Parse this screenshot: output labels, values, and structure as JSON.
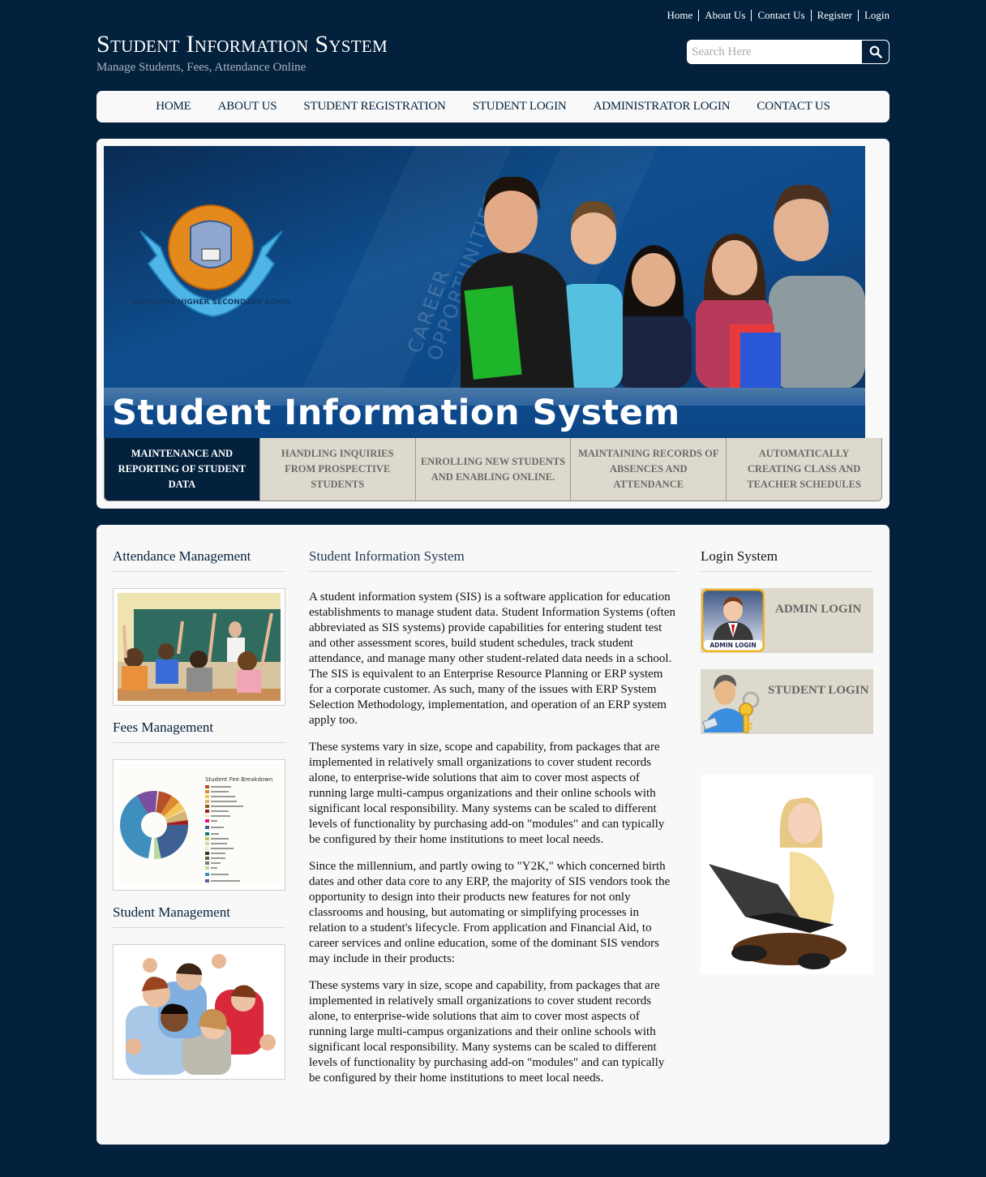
{
  "top_links": [
    "Home",
    "About Us",
    "Contact Us",
    "Register",
    "Login"
  ],
  "brand": {
    "title": "Student Information System",
    "tagline": "Manage Students, Fees, Attendance Online"
  },
  "search": {
    "placeholder": "Search Here",
    "value": "",
    "icon": "search-icon"
  },
  "nav": [
    "HOME",
    "ABOUT US",
    "STUDENT REGISTRATION",
    "STUDENT LOGIN",
    "ADMINISTRATOR LOGIN",
    "CONTACT US"
  ],
  "banner": {
    "title": "Student Information System",
    "watermark_line1": "CAREER",
    "watermark_line2": "OPPORTUNITIES",
    "logo_text": "ANNAPURNA HIGHER SECONDARY SCHOOL"
  },
  "feature_tabs": [
    {
      "label": "MAINTENANCE AND REPORTING OF STUDENT DATA",
      "active": true
    },
    {
      "label": "HANDLING INQUIRIES FROM PROSPECTIVE STUDENTS",
      "active": false
    },
    {
      "label": "ENROLLING NEW STUDENTS AND ENABLING ONLINE.",
      "active": false
    },
    {
      "label": "MAINTAINING RECORDS OF ABSENCES AND ATTENDANCE",
      "active": false
    },
    {
      "label": "AUTOMATICALLY CREATING CLASS AND TEACHER SCHEDULES",
      "active": false
    }
  ],
  "left": {
    "sections": [
      {
        "title": "Attendance Management",
        "image": "classroom-photo"
      },
      {
        "title": "Fees Management",
        "image": "fee-breakdown-chart",
        "chart_caption": "Student Fee Breakdown"
      },
      {
        "title": "Student Management",
        "image": "students-thumbs-up-photo"
      }
    ]
  },
  "main": {
    "title": "Student Information System",
    "paragraphs": [
      "A student information system (SIS) is a software application for education establishments to manage student data. Student Information Systems (often abbreviated as SIS systems) provide capabilities for entering student test and other assessment scores, build student schedules, track student attendance, and manage many other student-related data needs in a school. The SIS is equivalent to an Enterprise Resource Planning or ERP system for a corporate customer. As such, many of the issues with ERP System Selection Methodology, implementation, and operation of an ERP system apply too.",
      "These systems vary in size, scope and capability, from packages that are implemented in relatively small organizations to cover student records alone, to enterprise-wide solutions that aim to cover most aspects of running large multi-campus organizations and their online schools with significant local responsibility. Many systems can be scaled to different levels of functionality by purchasing add-on \"modules\" and can typically be configured by their home institutions to meet local needs.",
      "Since the millennium, and partly owing to \"Y2K,\" which concerned birth dates and other data core to any ERP, the majority of SIS vendors took the opportunity to design into their products new features for not only classrooms and housing, but automating or simplifying processes in relation to a student's lifecycle. From application and Financial Aid, to career services and online education, some of the dominant SIS vendors may include in their products:",
      "These systems vary in size, scope and capability, from packages that are implemented in relatively small organizations to cover student records alone, to enterprise-wide solutions that aim to cover most aspects of running large multi-campus organizations and their online schools with significant local responsibility. Many systems can be scaled to different levels of functionality by purchasing add-on \"modules\" and can typically be configured by their home institutions to meet local needs."
    ]
  },
  "right": {
    "title": "Login System",
    "admin_login": {
      "label": "ADMIN LOGIN",
      "badge": "ADMIN LOGIN"
    },
    "student_login": {
      "label": "STUDENT LOGIN"
    },
    "image": "girl-with-laptop-photo"
  },
  "colors": {
    "page_bg": "#03213c",
    "panel_bg": "#f8f8f8",
    "tab_bg": "#ddd9cc",
    "tab_active": "#03213c"
  }
}
